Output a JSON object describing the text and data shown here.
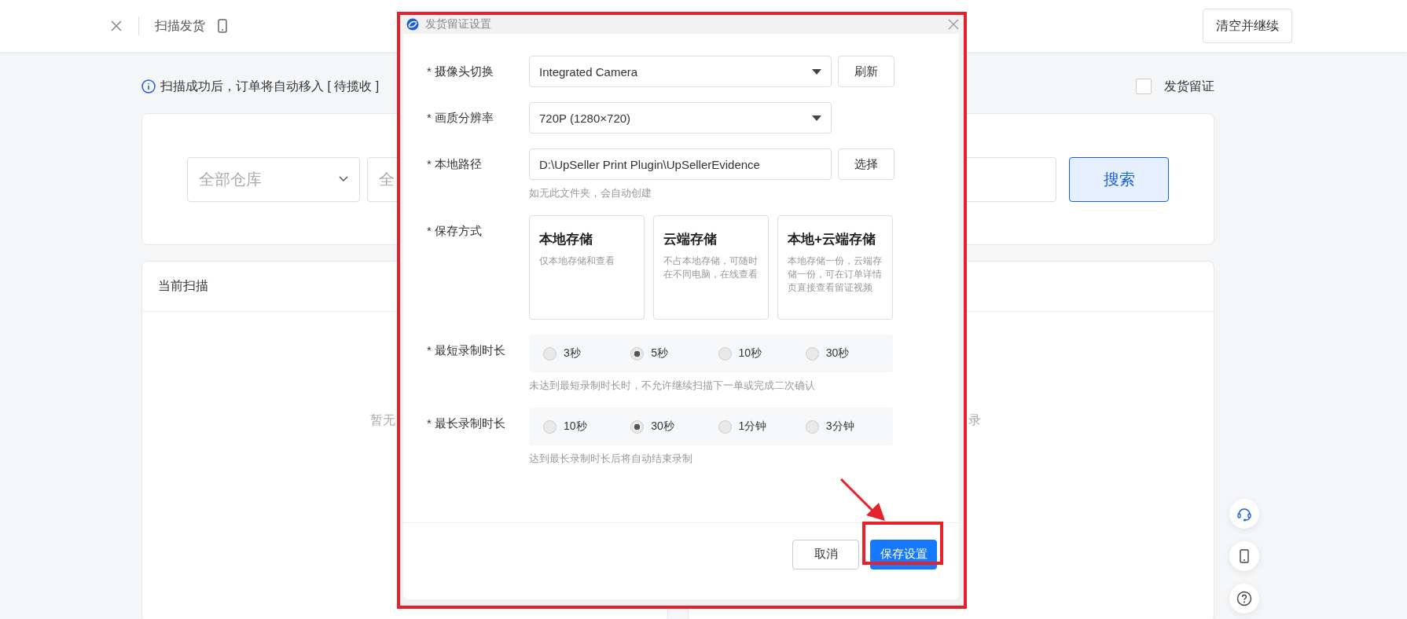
{
  "header": {
    "title": "扫描发货",
    "action": "清空并继续"
  },
  "notice": {
    "text": "扫描成功后，订单将自动移入 [ 待揽收 ]"
  },
  "evidence_toggle": {
    "label": "发货留证",
    "checked": false
  },
  "search": {
    "warehouse": "全部仓库",
    "field_2": "全",
    "button": "搜索"
  },
  "current_scan": {
    "title": "当前扫描",
    "empty_text": "暂无"
  },
  "history": {
    "empty_text": "录"
  },
  "dialog": {
    "title": "发货留证设置",
    "fields": [
      {
        "label": "* 摄像头切换",
        "kind": "select",
        "value": "Integrated Camera",
        "button": "刷新"
      },
      {
        "label": "* 画质分辨率",
        "kind": "select",
        "value": "720P (1280×720)"
      },
      {
        "label": "* 本地路径",
        "kind": "input",
        "value": "D:\\UpSeller Print Plugin\\UpSellerEvidence",
        "button": "选择",
        "hint": "如无此文件夹，会自动创建"
      }
    ],
    "storage": {
      "label": "* 保存方式",
      "options": [
        {
          "title": "本地存储",
          "desc": "仅本地存储和查看"
        },
        {
          "title": "云端存储",
          "desc": "不占本地存储，可随时在不同电脑，在线查看"
        },
        {
          "title": "本地+云端存储",
          "desc": "本地存储一份，云端存储一份，可在订单详情页直接查看留证视频"
        }
      ]
    },
    "durations": [
      {
        "label": "* 最短录制时长",
        "hint": "未达到最短录制时长时，不允许继续扫描下一单或完成二次确认",
        "options": [
          {
            "label": "3秒",
            "selected": false
          },
          {
            "label": "5秒",
            "selected": true
          },
          {
            "label": "10秒",
            "selected": false
          },
          {
            "label": "30秒",
            "selected": false
          }
        ]
      },
      {
        "label": "* 最长录制时长",
        "hint": "达到最长录制时长后将自动结束录制",
        "options": [
          {
            "label": "10秒",
            "selected": false
          },
          {
            "label": "30秒",
            "selected": true
          },
          {
            "label": "1分钟",
            "selected": false
          },
          {
            "label": "3分钟",
            "selected": false
          }
        ]
      }
    ],
    "cancel": "取消",
    "save": "保存设置"
  }
}
